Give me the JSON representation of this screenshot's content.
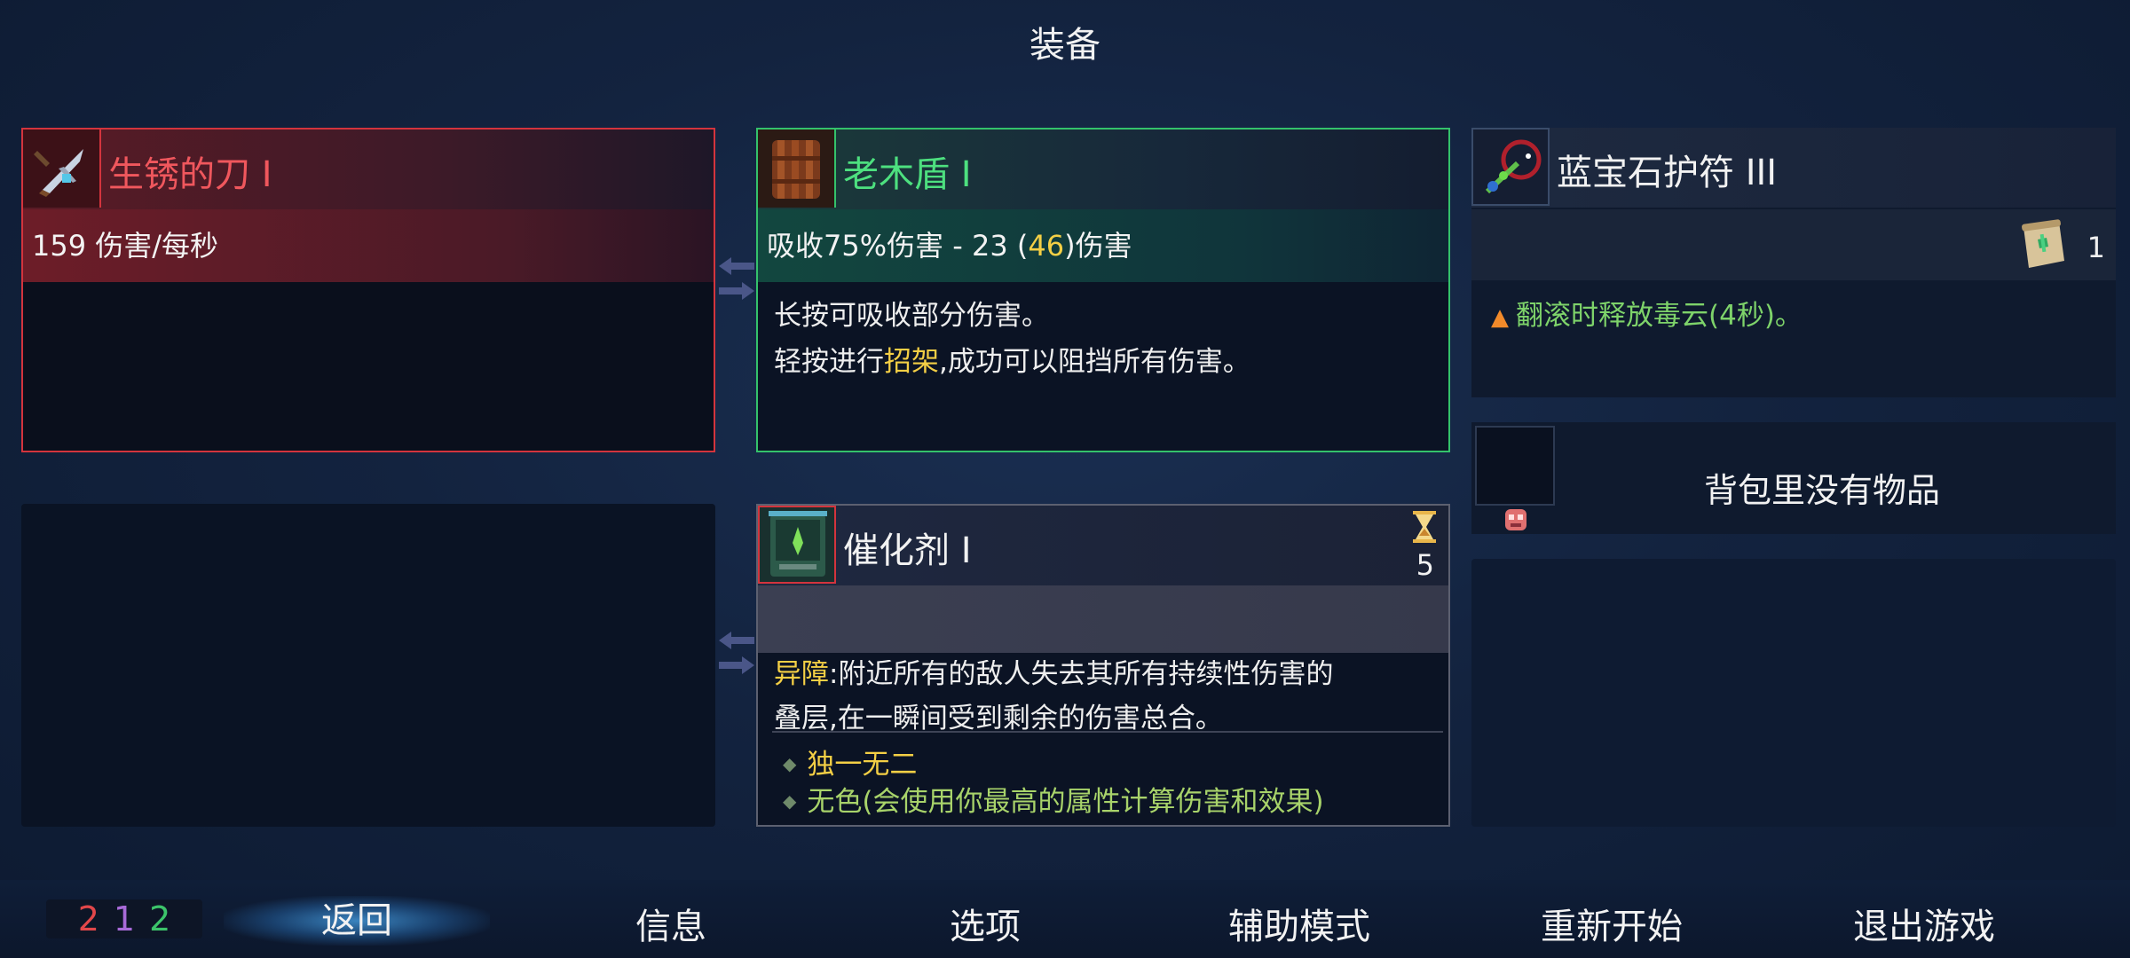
{
  "title": "装备",
  "weapon": {
    "name": "生锈的刀 I",
    "stat": "159 伤害/每秒",
    "icon": "rusty-sword-icon",
    "accent": "#d3343d"
  },
  "shield": {
    "name": "老木盾 I",
    "stat_prefix": "吸收75%伤害 - 23 (",
    "stat_highlight": "46",
    "stat_suffix": ")伤害",
    "desc_line1": "长按可吸收部分伤害。",
    "desc_line2_prefix": "轻按进行",
    "desc_line2_highlight": "招架",
    "desc_line2_suffix": ",成功可以阻挡所有伤害。",
    "icon": "wooden-shield-icon",
    "accent": "#34c26b"
  },
  "amulet": {
    "name": "蓝宝石护符 III",
    "scroll_count": "1",
    "effect": "翻滚时释放毒云(4秒)。",
    "icon": "sapphire-amulet-icon"
  },
  "backpack": {
    "empty_text": "背包里没有物品"
  },
  "catalyst": {
    "name": "催化剂 I",
    "cooldown": "5",
    "text1_highlight": "异障",
    "text1": ":附近所有的敌人失去其所有持续性伤害的",
    "text2": "叠层,在一瞬间受到剩余的伤害总合。",
    "tag1": "独一无二",
    "tag2": "无色(会使用你最高的属性计算伤害和效果)",
    "icon": "catalyst-tome-icon"
  },
  "stats": {
    "brutality": "2",
    "tactics": "1",
    "survival": "2",
    "colors": [
      "#e2474a",
      "#a86ad8",
      "#3cc46a"
    ]
  },
  "menu": {
    "back": "返回",
    "info": "信息",
    "options": "选项",
    "assist": "辅助模式",
    "restart": "重新开始",
    "quit": "退出游戏"
  }
}
